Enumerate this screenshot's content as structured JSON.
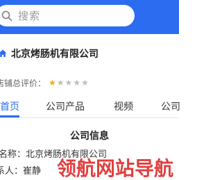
{
  "search": {
    "placeholder": "搜索",
    "icon": "search-icon"
  },
  "company": {
    "name": "北京烤肠机有限公司",
    "icon": "home-icon"
  },
  "rating": {
    "label": "店铺总评价：",
    "score": 1,
    "max": 5
  },
  "tabs": [
    {
      "label": "首页",
      "active": true
    },
    {
      "label": "公司产品",
      "active": false
    },
    {
      "label": "视频",
      "active": false
    },
    {
      "label": "公司",
      "active": false
    }
  ],
  "section": {
    "title": "公司信息"
  },
  "info": [
    {
      "label": "名称：",
      "value": "北京烤肠机有限公司"
    },
    {
      "label": "系人：",
      "value": "崔静"
    }
  ],
  "watermark": {
    "text": "领航网站导航"
  },
  "colors": {
    "brand": "#2c6cf0",
    "star": "#f2a71b",
    "watermark": "#dd2a2a"
  }
}
